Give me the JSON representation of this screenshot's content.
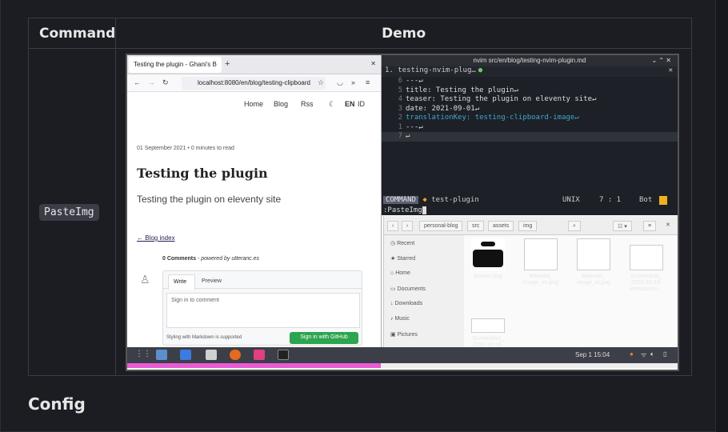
{
  "table": {
    "header_command": "Command",
    "header_demo": "Demo",
    "command": "PasteImg"
  },
  "next_heading": "Config",
  "firefox": {
    "tab_title": "Testing the plugin - Ghani's B",
    "url": "localhost:8080/en/blog/testing-clipboard",
    "nav": [
      "Home",
      "Blog",
      "Rss"
    ],
    "lang_en": "EN",
    "lang_id": "ID",
    "date": "01 September 2021 • 0 minutes to read",
    "post_title": "Testing the plugin",
    "teaser": "Testing the plugin on eleventy site",
    "blog_index": "← Blog index",
    "comments": "0 Comments",
    "powered": " - powered by utteranc.es",
    "tab_write": "Write",
    "tab_preview": "Preview",
    "comment_placeholder": "Sign in to comment",
    "markdown_note": "Styling with Markdown is supported",
    "github_button": "Sign in with GitHub"
  },
  "nvim": {
    "window_title": "nvim src/en/blog/testing-nvim-plugin.md",
    "tab": "1. testing-nvim-plug…",
    "lines": [
      {
        "n": "6",
        "t": "---↵"
      },
      {
        "n": "5",
        "t": "title: Testing the plugin↵"
      },
      {
        "n": "4",
        "t": "teaser: Testing the plugin on eleventy site↵"
      },
      {
        "n": "3",
        "t": "date: 2021-09-01↵"
      },
      {
        "n": "2",
        "t": "translationKey: testing-clipboard-image↵"
      },
      {
        "n": "1",
        "t": "---↵"
      },
      {
        "n": "7",
        "t": "↵"
      }
    ],
    "status_mode": "COMMAND",
    "status_branch": "test-plugin",
    "status_format": "UNIX",
    "status_pos": "7 : 1",
    "status_scroll": "Bot",
    "cmdline": ":PasteImg"
  },
  "files": {
    "crumbs": [
      "personal-blog",
      "src",
      "assets",
      "img"
    ],
    "sidebar": [
      "Recent",
      "Starred",
      "Home",
      "Documents",
      "Downloads",
      "Music",
      "Pictures"
    ],
    "items": [
      "favicon.png",
      "featured_\nimage_en.png",
      "featured_\nimage_id.png",
      "Screenshot_\n2020-10-19-\nutterances-i…",
      "Screenshot_\n2020-10-19-"
    ]
  },
  "panel": {
    "clock": "Sep 1  15:04"
  }
}
